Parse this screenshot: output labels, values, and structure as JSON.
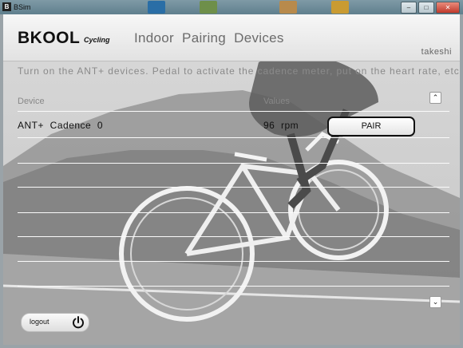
{
  "window": {
    "title": "BSim",
    "app_icon_letter": "B"
  },
  "header": {
    "logo": "BKOOL",
    "logo_sub": "Cycling",
    "nav_title": "Indoor  Pairing  Devices",
    "user": "takeshi"
  },
  "main": {
    "info_text": "Turn on the ANT+ devices. Pedal to activate the cadence meter, put on the heart rate, etc...",
    "columns": {
      "device": "Device",
      "values": "Values"
    },
    "rows": [
      {
        "device": "ANT+  Cadence  0",
        "value": "96  rpm",
        "action": "PAIR"
      }
    ]
  },
  "footer": {
    "logout_label": "logout"
  },
  "icons": {
    "scroll_up": "chevron-up-icon",
    "scroll_down": "chevron-down-icon",
    "power": "power-icon"
  },
  "colors": {
    "header_bg": "#f0f0f0",
    "pair_border": "#111111"
  }
}
